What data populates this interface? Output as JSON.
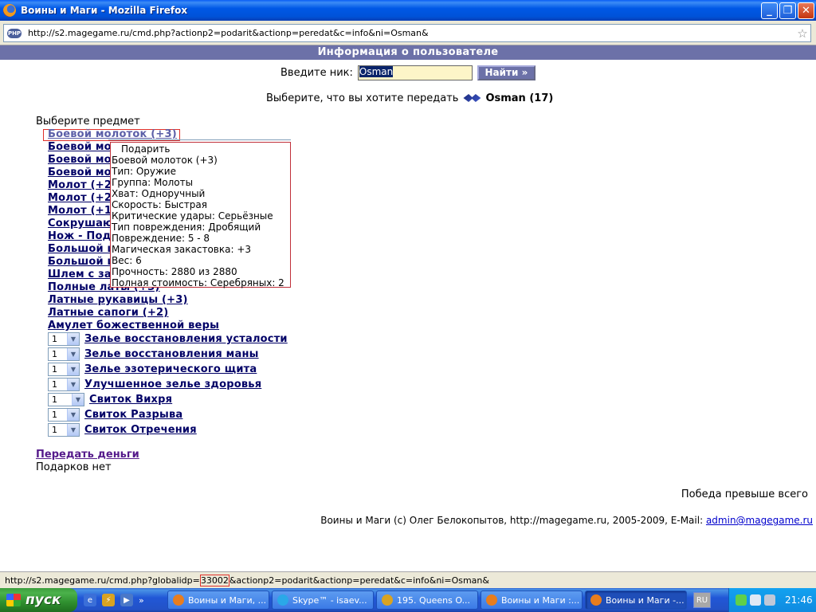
{
  "window": {
    "title": "Воины и Маги - Mozilla Firefox"
  },
  "address": {
    "url": "http://s2.magegame.ru/cmd.php?actionp2=podarit&actionp=peredat&c=info&ni=Osman&",
    "site_icon": "PHP"
  },
  "page": {
    "header": "Информация о пользователе",
    "nick_label": "Введите ник:",
    "nick_value": "Osman",
    "find_button": "Найти »",
    "transfer_text": "Выберите, что вы хотите передать",
    "target_user": "Osman (17)",
    "choose_item": "Выберите предмет",
    "items": [
      "Боевой молоток (+3)",
      "Боевой мо",
      "Боевой мо",
      "Боевой мо",
      "Молот (+2",
      "Молот (+2",
      "Молот (+1",
      "Сокрушаю",
      "Нож - Под",
      "Большой щ",
      "Большой щ",
      "Шлем с за",
      "Полные латы (+3)",
      "Латные рукавицы (+3)",
      "Латные сапоги (+2)",
      "Амулет божественной веры"
    ],
    "potions": [
      {
        "qty": "1",
        "label": "Зелье восстановления усталости"
      },
      {
        "qty": "1",
        "label": "Зелье восстановления маны"
      },
      {
        "qty": "1",
        "label": "Зелье эзотерического щита"
      },
      {
        "qty": "1",
        "label": "Улучшенное зелье здоровья"
      },
      {
        "qty": "1",
        "label": "Свиток Вихря"
      },
      {
        "qty": "1",
        "label": "Свиток Разрыва"
      },
      {
        "qty": "1",
        "label": "Свиток Отречения"
      }
    ],
    "tooltip": {
      "gift": "Подарить",
      "lines": [
        "Боевой молоток (+3)",
        "Тип: Оружие",
        "Группа: Молоты",
        "Хват: Одноручный",
        "Скорость: Быстрая",
        "Критические удары: Серьёзные",
        "Тип повреждения: Дробящий",
        "Повреждение: 5 - 8",
        "Магическая закастовка: +3",
        "Вес: 6",
        "Прочность: 2880 из 2880",
        "Полная стоимость: Серебряных: 2"
      ]
    },
    "money_link": "Передать деньги",
    "no_gifts": "Подарков нет",
    "motto": "Победа превыше всего",
    "footer_text": "Воины и Маги (c) Олег Белокопытов, http://magegame.ru, 2005-2009, E-Mail:",
    "footer_email": "admin@magegame.ru"
  },
  "status": {
    "pre": "http://s2.magegame.ru/cmd.php?globalidp=",
    "highlight": "33002",
    "post": "&actionp2=podarit&actionp=peredat&c=info&ni=Osman&"
  },
  "taskbar": {
    "start": "пуск",
    "tasks": [
      "Воины и Маги, ...",
      "Skype™ - isaev...",
      "195. Queens O...",
      "Воины и Маги :...",
      "Воины и Маги -..."
    ],
    "lang": "RU",
    "clock": "21:46",
    "more": "»"
  }
}
